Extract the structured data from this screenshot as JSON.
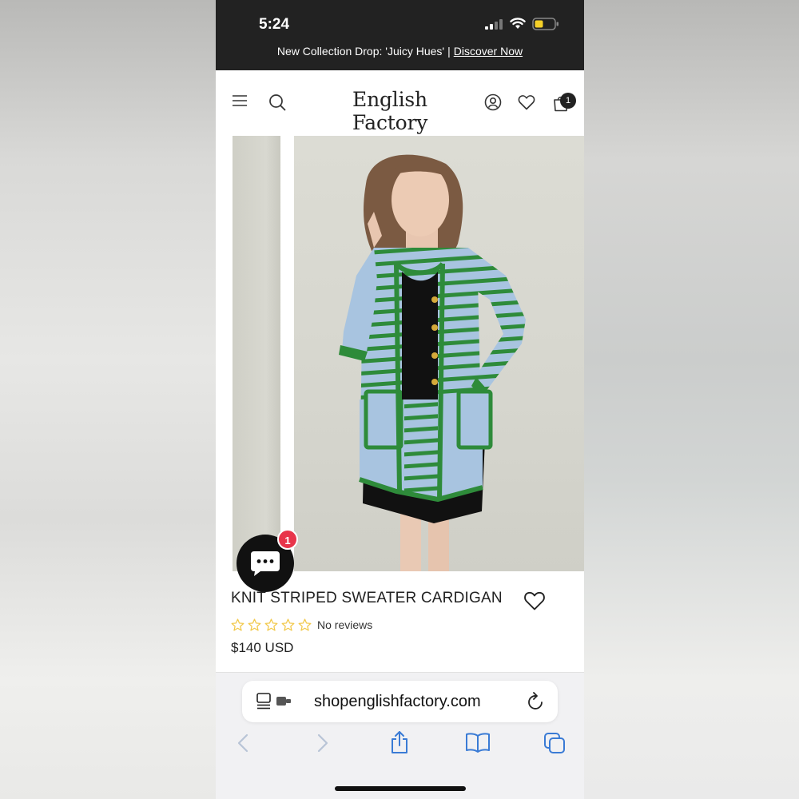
{
  "status_bar": {
    "time": "5:24"
  },
  "announcement": {
    "text": "New Collection Drop: 'Juicy Hues'",
    "separator": "|",
    "link": "Discover Now"
  },
  "header": {
    "brand": "English Factory",
    "cart_count": "1"
  },
  "product": {
    "title": "KNIT STRIPED SWEATER CARDIGAN",
    "reviews": "No reviews",
    "rating": 0,
    "rating_max": 5,
    "price": "$140 USD"
  },
  "chat": {
    "badge_count": "1"
  },
  "browser": {
    "url": "shopenglishfactory.com"
  },
  "colors": {
    "dark": "#222222",
    "star": "#f2c94c",
    "chat_badge": "#e8344a",
    "safari_blue": "#3a7bd5",
    "cardigan_blue": "#a8c4e0",
    "cardigan_green": "#2e8b3a"
  },
  "icons": {
    "menu": "menu-icon",
    "search": "search-icon",
    "account": "account-icon",
    "wishlist": "heart-icon",
    "cart": "bag-icon",
    "chat": "chat-icon",
    "reader": "reader-icon",
    "reload": "reload-icon",
    "back": "chevron-left-icon",
    "forward": "chevron-right-icon",
    "share": "share-icon",
    "bookmarks": "book-icon",
    "tabs": "tabs-icon"
  }
}
